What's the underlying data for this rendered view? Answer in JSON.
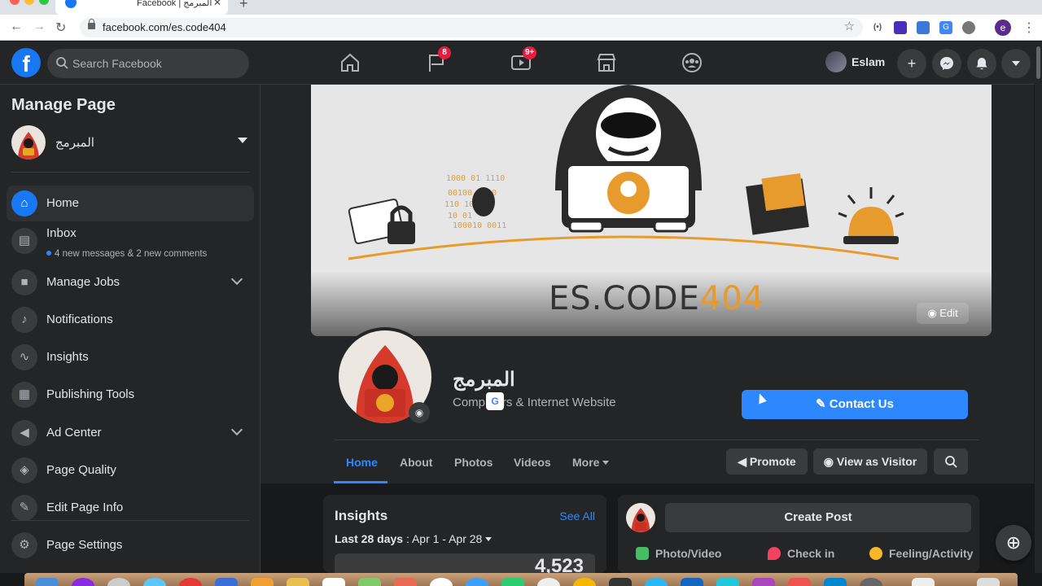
{
  "browser": {
    "tab_title": "Facebook | المبرمج",
    "tab_close": "✕",
    "new_tab": "+",
    "url": "facebook.com/es.code404",
    "back": "←",
    "forward": "→",
    "reload": "↻",
    "bookmark_star": "☆",
    "menu": "⋮",
    "profile_initial": "e"
  },
  "topbar": {
    "logo": "f",
    "search_placeholder": "Search Facebook",
    "flag_badge": "8",
    "watch_badge": "9+",
    "user_name": "Eslam",
    "create": "+",
    "icons": [
      "home-icon",
      "flag-icon",
      "watch-icon",
      "marketplace-icon",
      "groups-icon",
      "messenger-icon",
      "notifications-icon",
      "account-menu-icon"
    ]
  },
  "sidebar": {
    "title": "Manage Page",
    "page_name": "المبرمج",
    "items": [
      {
        "label": "Home",
        "icon": "home-icon"
      },
      {
        "label": "Inbox",
        "sub": "4 new messages & 2 new comments",
        "icon": "inbox-icon"
      },
      {
        "label": "Manage Jobs",
        "icon": "briefcase-icon"
      },
      {
        "label": "Notifications",
        "icon": "bell-icon"
      },
      {
        "label": "Insights",
        "icon": "insights-icon"
      },
      {
        "label": "Publishing Tools",
        "icon": "publishing-icon"
      },
      {
        "label": "Ad Center",
        "icon": "megaphone-icon"
      },
      {
        "label": "Page Quality",
        "icon": "shield-icon"
      },
      {
        "label": "Edit Page Info",
        "icon": "pencil-icon"
      },
      {
        "label": "Page Settings",
        "icon": "gear-icon"
      }
    ]
  },
  "page": {
    "cover_brand_text": "ES.CODE",
    "cover_brand_num": "404",
    "cover_edit": "Edit",
    "name": "المبرمج",
    "category": "Computers & Internet Website",
    "contact_button": "Contact Us",
    "tabs": [
      "Home",
      "About",
      "Photos",
      "Videos",
      "More"
    ],
    "promote": "Promote",
    "view_as_visitor": "View as Visitor"
  },
  "insights_card": {
    "title": "Insights",
    "see_all": "See All",
    "range_label": "Last 28 days",
    "range": " : Apr 1 - Apr 28",
    "value": "4,523"
  },
  "create_post": {
    "button": "Create Post",
    "actions": [
      "Photo/Video",
      "Check in",
      "Feeling/Activity"
    ]
  },
  "colors": {
    "accent": "#2d88ff",
    "fb_blue": "#1877f2",
    "badge_red": "#e41e3f",
    "bg_dark": "#18191a",
    "surface": "#242526"
  }
}
